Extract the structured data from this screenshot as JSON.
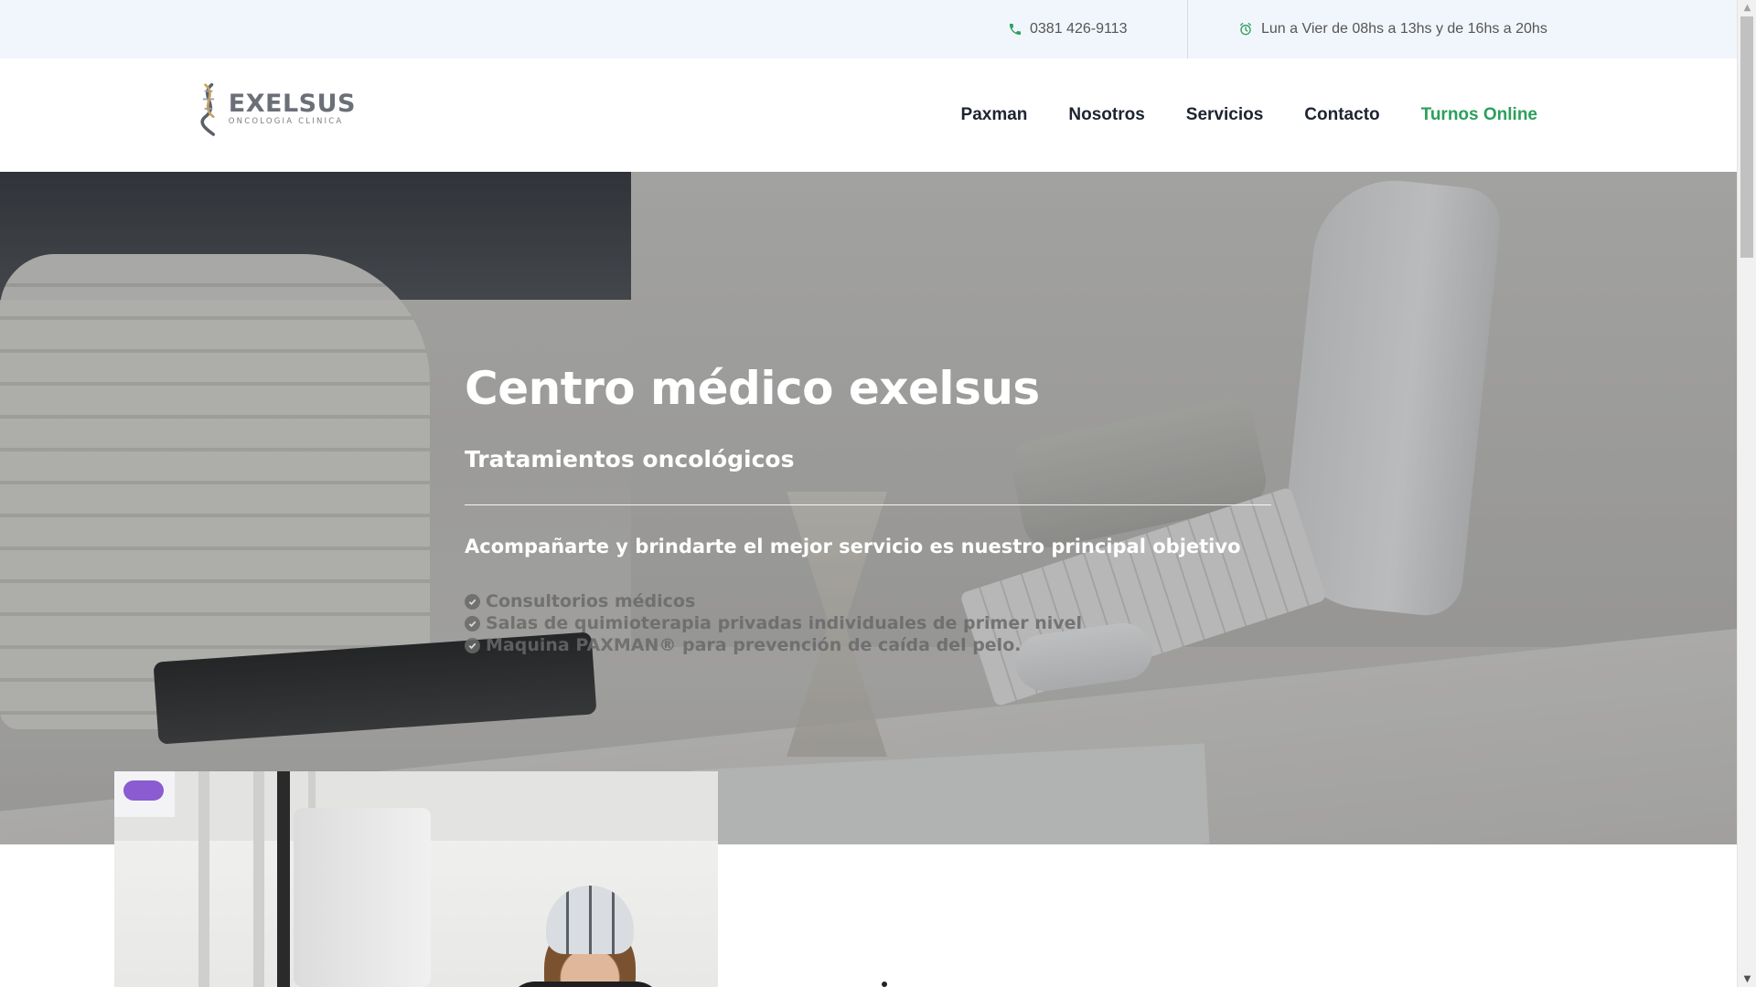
{
  "topbar": {
    "phone_icon": "phone-icon",
    "phone": "0381 426-9113",
    "hours_icon": "alarm-clock-icon",
    "hours": "Lun a Vier de 08hs a 13hs y de 16hs a 20hs"
  },
  "logo": {
    "name": "EXELSUS",
    "tagline": "ONCOLOGIA CLINICA"
  },
  "nav": {
    "items": [
      {
        "label": "Paxman"
      },
      {
        "label": "Nosotros"
      },
      {
        "label": "Servicios"
      },
      {
        "label": "Contacto"
      },
      {
        "label": "Turnos Online"
      }
    ]
  },
  "hero": {
    "title": "Centro médico exelsus",
    "subtitle": "Tratamientos oncológicos",
    "tagline": "Acompañarte y brindarte el mejor servicio es nuestro principal objetivo",
    "features": [
      "Consultorios médicos",
      "Salas de quimioterapia privadas individuales de primer nivel",
      "Maquina PAXMAN® para prevención de caída del pelo."
    ]
  },
  "colors": {
    "accent": "#2aa05a",
    "topbar_bg": "#f1f6fc",
    "nav_text": "#1d2430"
  }
}
